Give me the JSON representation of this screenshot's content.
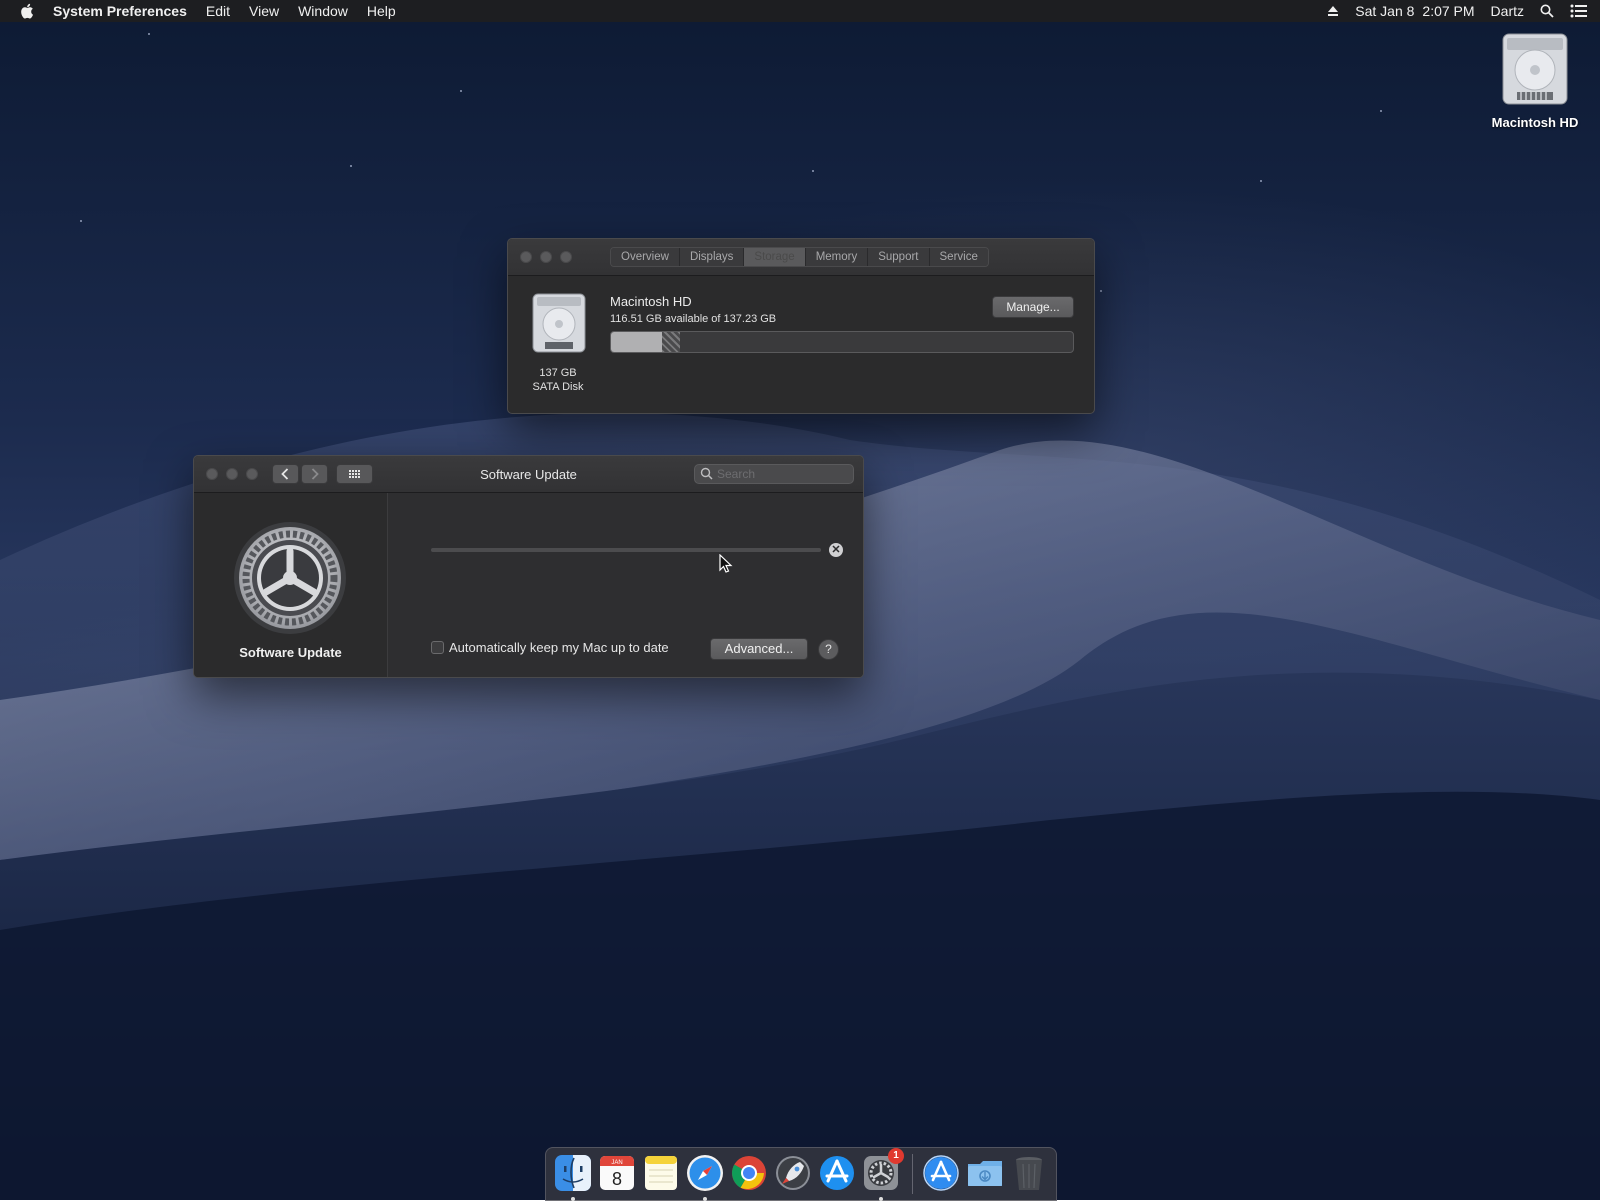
{
  "menubar": {
    "app_name": "System Preferences",
    "menus": [
      "Edit",
      "View",
      "Window",
      "Help"
    ],
    "date": "Sat Jan 8",
    "time": "2:07 PM",
    "user": "Dartz"
  },
  "desktop": {
    "icon_label": "Macintosh HD"
  },
  "about_window": {
    "tabs": [
      "Overview",
      "Displays",
      "Storage",
      "Memory",
      "Support",
      "Service"
    ],
    "active_tab": "Storage",
    "disk_size": "137 GB",
    "disk_type": "SATA Disk",
    "volume_name": "Macintosh HD",
    "volume_available": "116.51 GB available of 137.23 GB",
    "manage_label": "Manage...",
    "storage": {
      "used_fraction": 0.11,
      "other_fraction": 0.04
    }
  },
  "software_update": {
    "title": "Software Update",
    "search_placeholder": "Search",
    "sidebar_name": "Software Update",
    "auto_update_label": "Automatically keep my Mac up to date",
    "auto_update_checked": false,
    "advanced_label": "Advanced...",
    "help_label": "?",
    "progress_value": 0
  },
  "dock": {
    "items": [
      "finder-icon",
      "calendar-icon",
      "notes-icon",
      "safari-icon",
      "chrome-icon",
      "launchpad-icon",
      "app-store-icon",
      "system-preferences-icon",
      "app-store-folder-icon",
      "downloads-folder-icon",
      "trash-icon"
    ],
    "calendar_day": "8",
    "calendar_month": "JAN",
    "system_preferences_badge": "1"
  }
}
